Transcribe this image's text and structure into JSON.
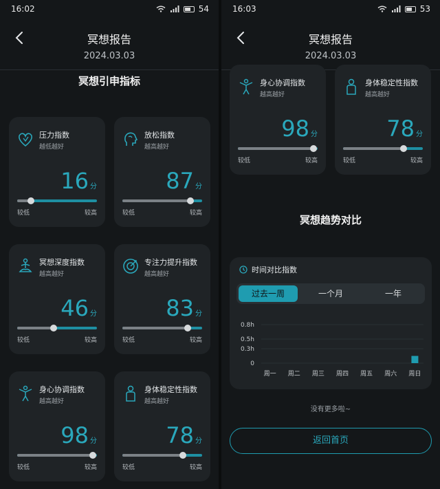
{
  "left": {
    "status": {
      "time": "16:02",
      "signal": "4G",
      "battery": "54"
    },
    "header": {
      "title": "冥想报告",
      "date": "2024.03.03"
    },
    "section_title": "冥想引申指标",
    "cards": [
      {
        "name": "压力指数",
        "sub": "越低越好",
        "score": "16",
        "unit": "分",
        "level": 0.17,
        "low": "较低",
        "high": "较高",
        "icon": "heart-icon"
      },
      {
        "name": "放松指数",
        "sub": "越高越好",
        "score": "87",
        "unit": "分",
        "level": 0.85,
        "low": "较低",
        "high": "较高",
        "icon": "head-profile-icon"
      },
      {
        "name": "冥想深度指数",
        "sub": "越高越好",
        "score": "46",
        "unit": "分",
        "level": 0.46,
        "low": "较低",
        "high": "较高",
        "icon": "meditation-pose-icon"
      },
      {
        "name": "专注力提升指数",
        "sub": "越高越好",
        "score": "83",
        "unit": "分",
        "level": 0.82,
        "low": "较低",
        "high": "较高",
        "icon": "target-icon"
      },
      {
        "name": "身心协调指数",
        "sub": "越高越好",
        "score": "98",
        "unit": "分",
        "level": 0.95,
        "low": "较低",
        "high": "较高",
        "icon": "balance-figure-icon"
      },
      {
        "name": "身体稳定性指数",
        "sub": "越高越好",
        "score": "78",
        "unit": "分",
        "level": 0.76,
        "low": "较低",
        "high": "较高",
        "icon": "body-figure-icon"
      }
    ]
  },
  "right": {
    "status": {
      "time": "16:03",
      "signal": "4G",
      "battery": "53"
    },
    "header": {
      "title": "冥想报告",
      "date": "2024.03.03"
    },
    "cards": [
      {
        "name": "身心协调指数",
        "sub": "越高越好",
        "score": "98",
        "unit": "分",
        "level": 0.95,
        "low": "较低",
        "high": "较高",
        "icon": "balance-figure-icon"
      },
      {
        "name": "身体稳定性指数",
        "sub": "越高越好",
        "score": "78",
        "unit": "分",
        "level": 0.76,
        "low": "较低",
        "high": "较高",
        "icon": "body-figure-icon"
      }
    ],
    "trend_title": "冥想趋势对比",
    "trend_card": {
      "label": "时间对比指数",
      "tabs": [
        {
          "label": "过去一周",
          "active": true
        },
        {
          "label": "一个月",
          "active": false
        },
        {
          "label": "一年",
          "active": false
        }
      ]
    },
    "more_text": "没有更多啦~",
    "home_button": "返回首页"
  },
  "chart_data": {
    "type": "bar",
    "categories": [
      "周一",
      "周二",
      "周三",
      "周四",
      "周五",
      "周六",
      "周日"
    ],
    "values": [
      0,
      0,
      0,
      0,
      0,
      0,
      0.15
    ],
    "yticks": [
      "0",
      "0.3h",
      "0.5h",
      "0.8h"
    ],
    "ytick_values": [
      0,
      0.3,
      0.5,
      0.8
    ],
    "ylim": [
      0,
      0.8
    ],
    "grid": true
  },
  "colors": {
    "accent": "#1f9cb0",
    "card": "#1f2326",
    "background": "#141719"
  }
}
